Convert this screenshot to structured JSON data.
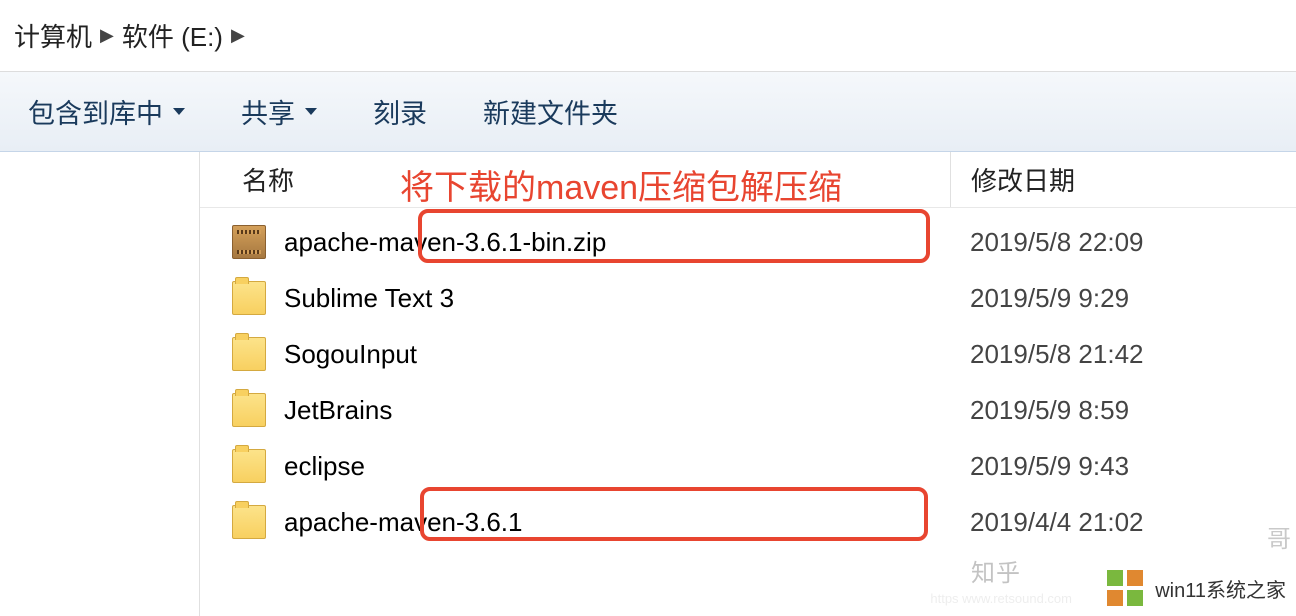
{
  "breadcrumbs": {
    "items": [
      "计算机",
      "软件 (E:)"
    ]
  },
  "toolbar": {
    "include_in_library": "包含到库中",
    "share": "共享",
    "burn": "刻录",
    "new_folder": "新建文件夹"
  },
  "columns": {
    "name": "名称",
    "date": "修改日期"
  },
  "annotation": "将下载的maven压缩包解压缩",
  "files": [
    {
      "name": "apache-maven-3.6.1-bin.zip",
      "date": "2019/5/8 22:09",
      "type": "zip"
    },
    {
      "name": "Sublime Text 3",
      "date": "2019/5/9 9:29",
      "type": "folder"
    },
    {
      "name": "SogouInput",
      "date": "2019/5/8 21:42",
      "type": "folder"
    },
    {
      "name": "JetBrains",
      "date": "2019/5/9 8:59",
      "type": "folder"
    },
    {
      "name": "eclipse",
      "date": "2019/5/9 9:43",
      "type": "folder"
    },
    {
      "name": "apache-maven-3.6.1",
      "date": "2019/4/4 21:02",
      "type": "folder"
    }
  ],
  "watermarks": {
    "zhihu": "知乎",
    "retsound": "https    www.retsound.com",
    "win11": "win11系统之家",
    "corner": "哥"
  }
}
